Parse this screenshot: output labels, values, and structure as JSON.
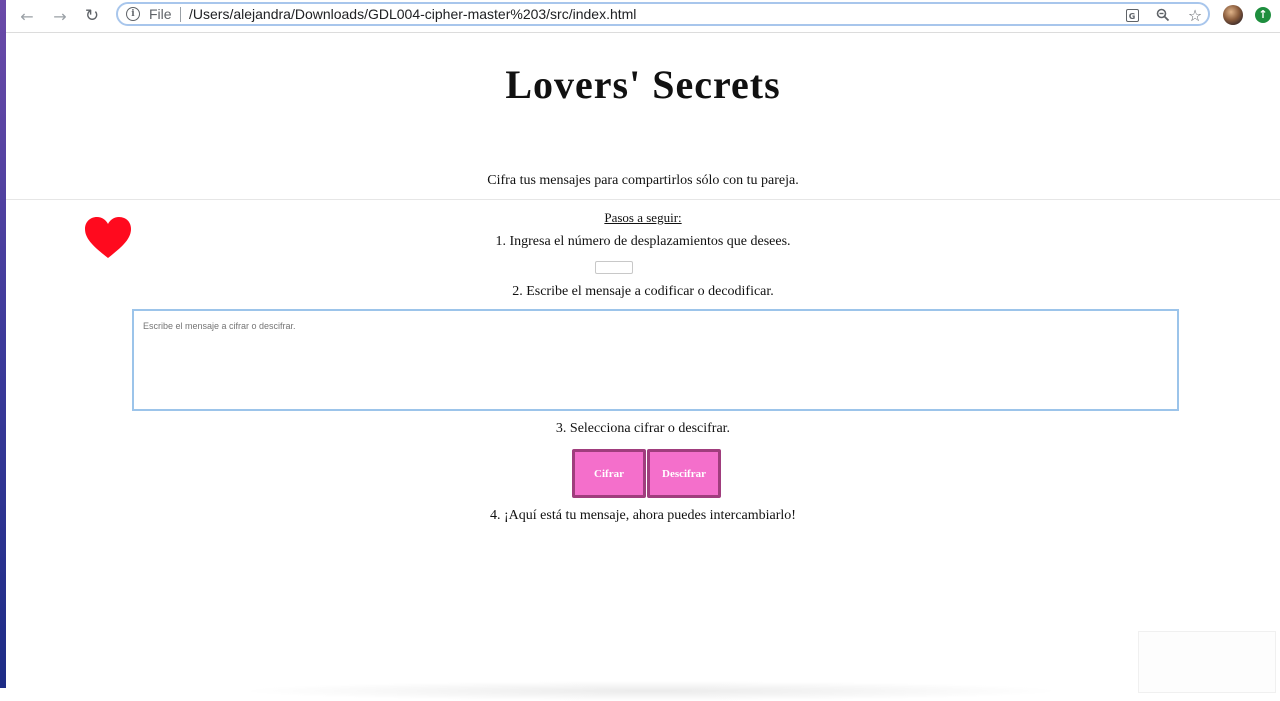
{
  "browser": {
    "scheme_label": "File",
    "url": "/Users/alejandra/Downloads/GDL004-cipher-master%203/src/index.html",
    "icons": {
      "back": "arrow-left-icon",
      "forward": "arrow-right-icon",
      "reload": "reload-icon",
      "info": "info-icon",
      "translate": "translate-icon",
      "zoom": "zoom-icon",
      "bookmark": "star-icon",
      "profile": "avatar",
      "update": "update-icon"
    },
    "info_glyph": "i",
    "translate_glyph": "G"
  },
  "page": {
    "title": "Lovers' Secrets",
    "subtitle": "Cifra tus mensajes para compartirlos sólo con tu pareja.",
    "steps_heading": "Pasos a seguir:",
    "step1": "1. Ingresa el número de desplazamientos que desees.",
    "step2": "2. Escribe el mensaje a codificar o decodificar.",
    "message_placeholder": "Escribe el mensaje a cifrar o descifrar.",
    "step3": "3. Selecciona cifrar o descifrar.",
    "encrypt_label": "Cifrar",
    "decrypt_label": "Descifrar",
    "step4": "4. ¡Aquí está tu mensaje, ahora puedes intercambiarlo!"
  },
  "colors": {
    "heart": "#ff0a1e",
    "button_fill": "#f46fcb",
    "button_border": "#a03d7d",
    "textarea_border": "#9cc4ea",
    "omnibox_border": "#a8c6ec"
  }
}
